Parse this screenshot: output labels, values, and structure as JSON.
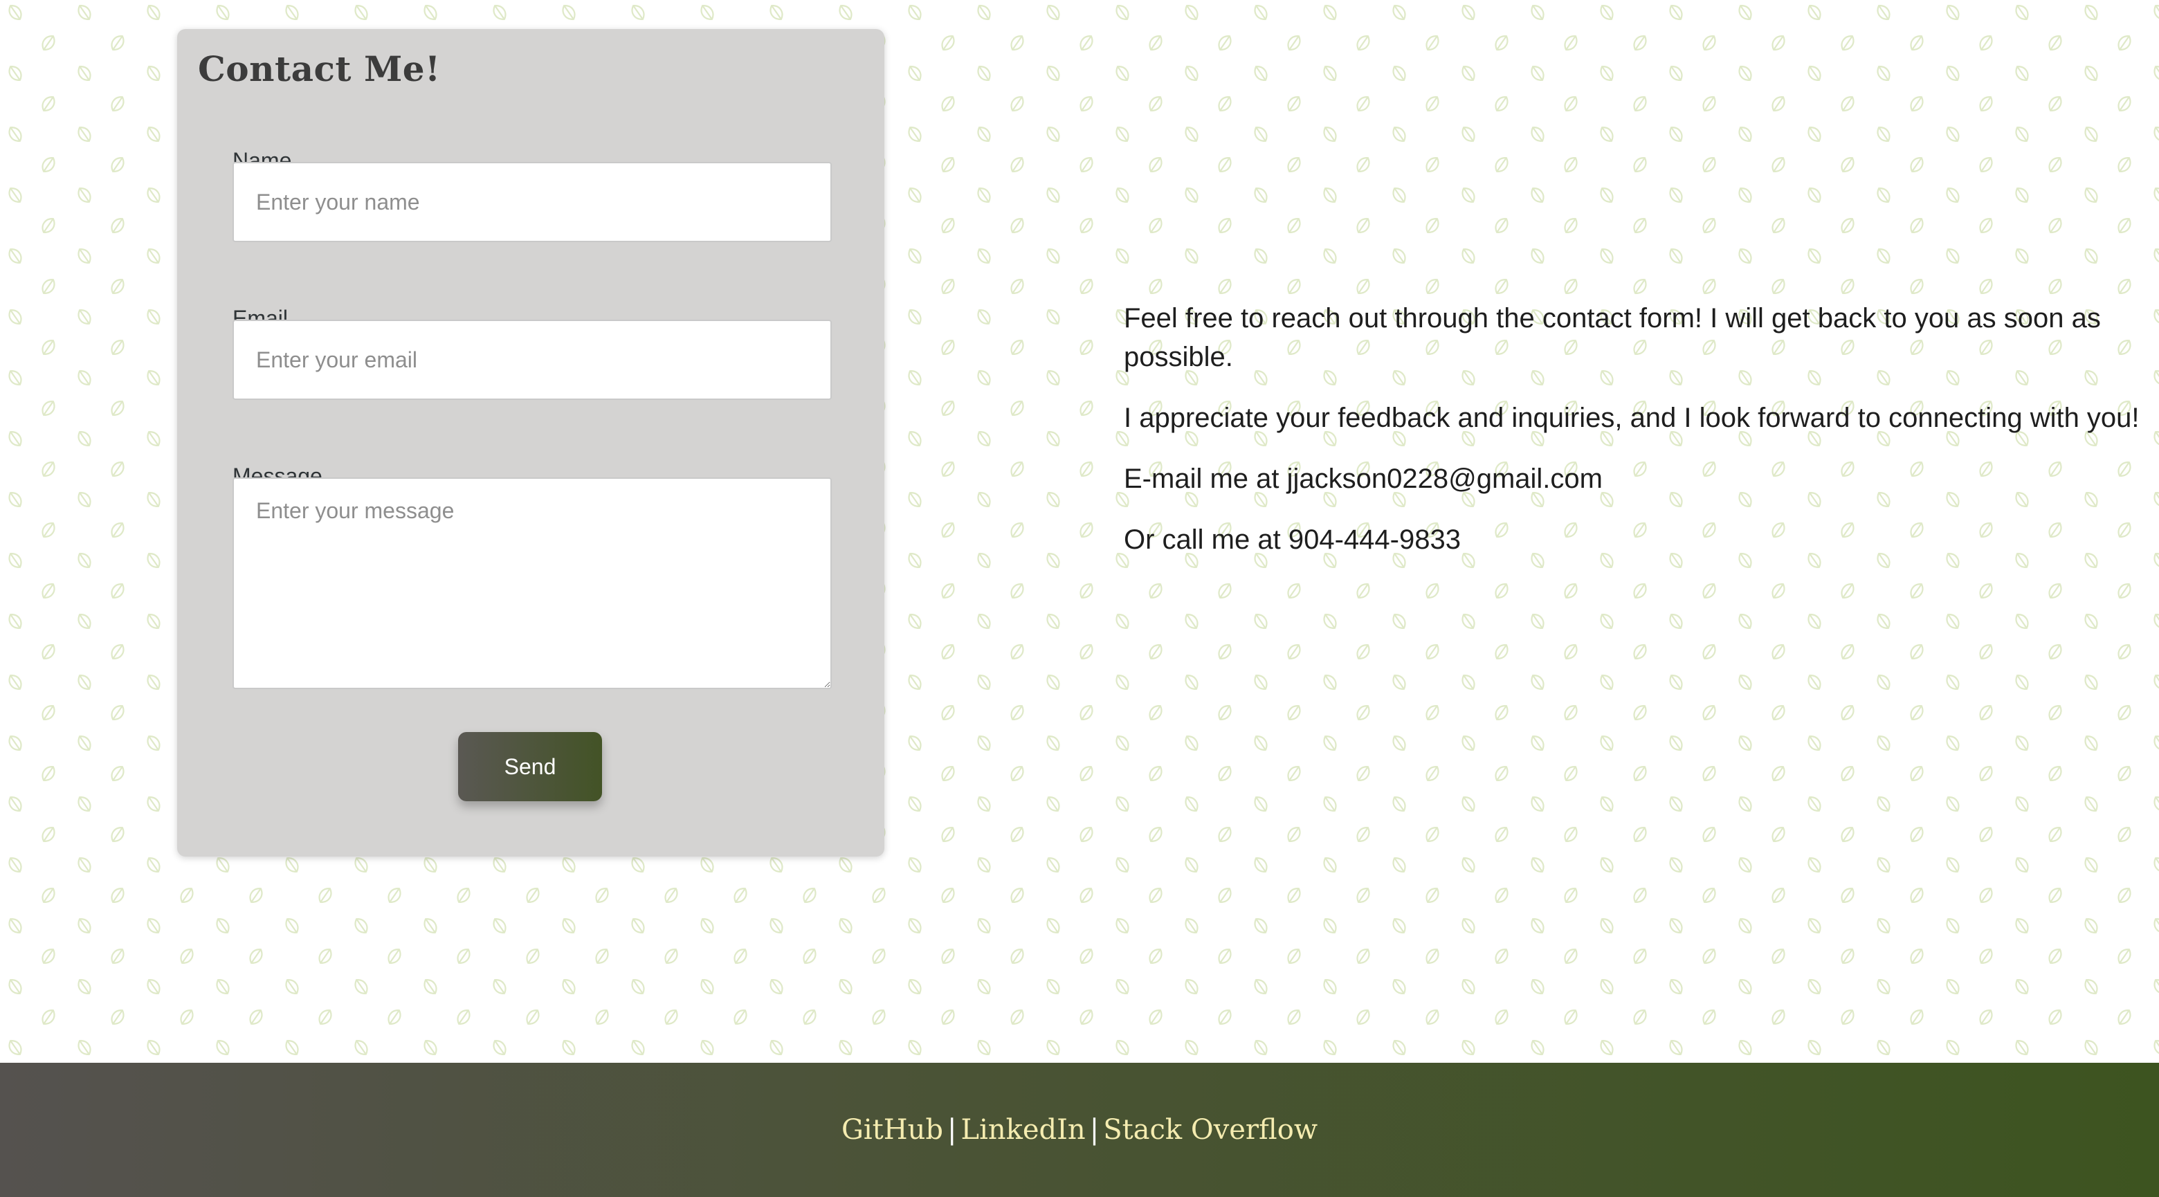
{
  "contact_form": {
    "title": "Contact Me!",
    "name_label": "Name",
    "name_placeholder": "Enter your name",
    "name_value": "",
    "email_label": "Email",
    "email_placeholder": "Enter your email",
    "email_value": "",
    "message_label": "Message",
    "message_placeholder": "Enter your message",
    "message_value": "",
    "send_label": "Send"
  },
  "info": {
    "paragraph_1": "Feel free to reach out through the contact form! I will get back to you as soon as possible.",
    "paragraph_2": "I appreciate your feedback and inquiries, and I look forward to connecting with you!",
    "email_line": "E-mail me at jjackson0228@gmail.com",
    "phone_line": "Or call me at 904-444-9833"
  },
  "footer": {
    "links": [
      "GitHub",
      "LinkedIn",
      "Stack Overflow"
    ],
    "separator": "|"
  },
  "colors": {
    "card_background": "#d4d3d2",
    "button_gradient_start": "#5a5853",
    "button_gradient_end": "#435326",
    "footer_gradient_start": "#55524f",
    "footer_gradient_end": "#3d5420",
    "footer_link": "#f5ecb0",
    "leaf_pattern": "#dfe9c8"
  },
  "background_pattern_icon": "leaf-icon"
}
